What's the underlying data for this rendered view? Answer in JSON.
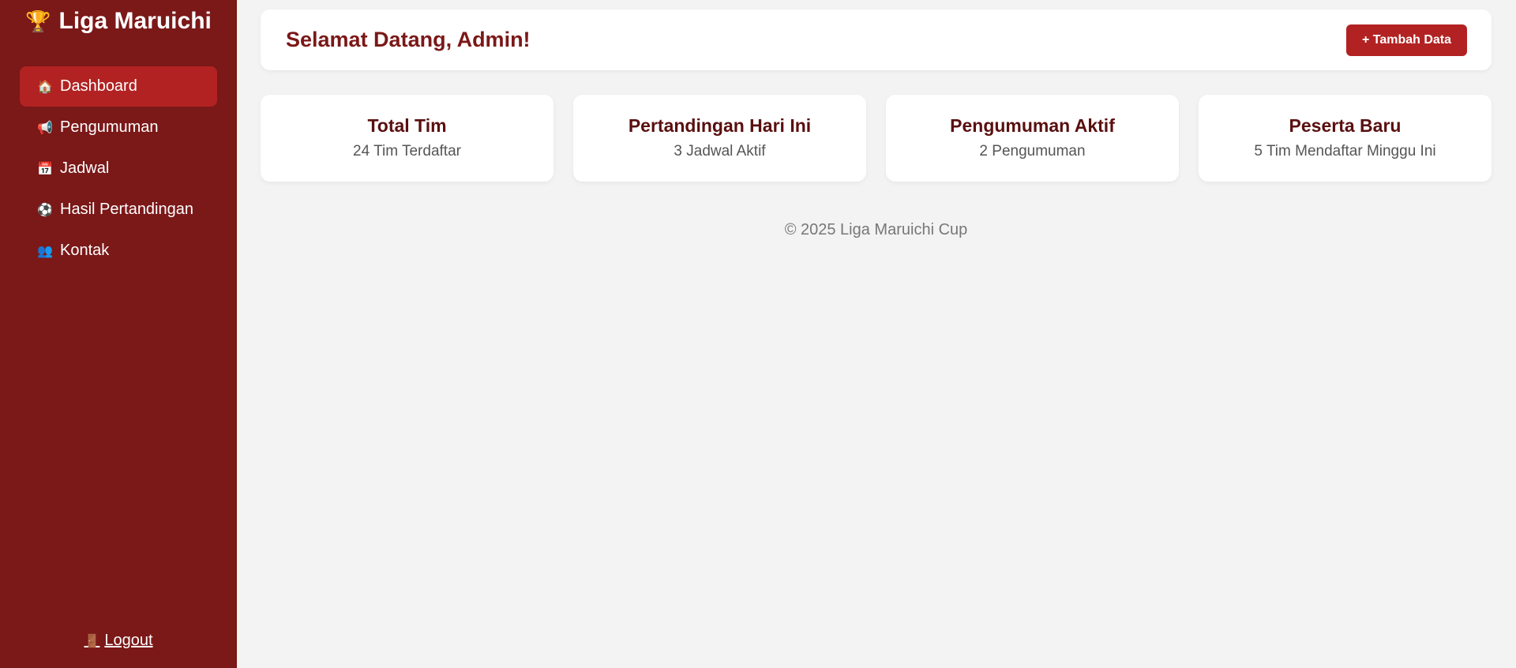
{
  "sidebar": {
    "brand_icon": "🏆",
    "brand": "Liga Maruichi",
    "items": [
      {
        "icon": "🏠",
        "icon_name": "home-icon",
        "label": "Dashboard",
        "active": true
      },
      {
        "icon": "📢",
        "icon_name": "megaphone-icon",
        "label": "Pengumuman"
      },
      {
        "icon": "📅",
        "icon_name": "calendar-icon",
        "label": "Jadwal"
      },
      {
        "icon": "⚽",
        "icon_name": "soccer-ball-icon",
        "label": "Hasil Pertandingan"
      },
      {
        "icon": "👥",
        "icon_name": "people-icon",
        "label": "Kontak"
      }
    ],
    "logout_icon": "🚪",
    "logout": "Logout"
  },
  "header": {
    "title": "Selamat Datang, Admin!",
    "add_button": "+ Tambah Data"
  },
  "cards": [
    {
      "title": "Total Tim",
      "value": "24 Tim Terdaftar"
    },
    {
      "title": "Pertandingan Hari Ini",
      "value": "3 Jadwal Aktif"
    },
    {
      "title": "Pengumuman Aktif",
      "value": "2 Pengumuman"
    },
    {
      "title": "Peserta Baru",
      "value": "5 Tim Mendaftar Minggu Ini"
    }
  ],
  "footer": "© 2025 Liga Maruichi Cup",
  "colors": {
    "sidebar_bg": "#7b1818",
    "accent": "#b22222",
    "background": "#f3f3f3"
  }
}
